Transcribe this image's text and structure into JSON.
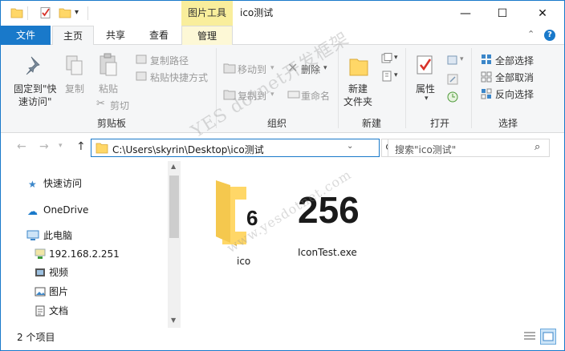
{
  "titlebar": {
    "context_tab": "图片工具",
    "title": "ico测试",
    "minimize": "—",
    "maximize": "☐",
    "close": "✕"
  },
  "tabs": {
    "file": "文件",
    "home": "主页",
    "share": "共享",
    "view": "查看",
    "manage": "管理"
  },
  "ribbon": {
    "clipboard": {
      "pin": "固定到\"快",
      "pin2": "速访问\"",
      "copy": "复制",
      "paste": "粘贴",
      "copy_path": "复制路径",
      "paste_shortcut": "粘贴快捷方式",
      "cut": "剪切",
      "label": "剪贴板"
    },
    "organize": {
      "move_to": "移动到",
      "copy_to": "复制到",
      "delete": "删除",
      "rename": "重命名",
      "label": "组织"
    },
    "new": {
      "new_folder": "新建",
      "new_folder2": "文件夹",
      "label": "新建"
    },
    "open": {
      "properties": "属性",
      "label": "打开"
    },
    "select": {
      "select_all": "全部选择",
      "select_none": "全部取消",
      "invert": "反向选择",
      "label": "选择"
    }
  },
  "address": {
    "path": "C:\\Users\\skyrin\\Desktop\\ico测试",
    "search_placeholder": "搜索\"ico测试\""
  },
  "nav": {
    "items": [
      {
        "label": "快速访问",
        "icon": "star-icon"
      },
      {
        "label": "OneDrive",
        "icon": "cloud-icon"
      },
      {
        "label": "此电脑",
        "icon": "computer-icon"
      },
      {
        "label": "192.168.2.251",
        "icon": "network-drive-icon"
      },
      {
        "label": "视频",
        "icon": "video-icon"
      },
      {
        "label": "图片",
        "icon": "picture-icon"
      },
      {
        "label": "文档",
        "icon": "document-icon"
      }
    ]
  },
  "files": [
    {
      "name": "ico",
      "overlay": "6",
      "icon": "folder-icon"
    },
    {
      "name": "IconTest.exe",
      "overlay": "256",
      "icon": "exe-icon"
    }
  ],
  "status": {
    "count": "2 个项目"
  },
  "watermark": {
    "line1": "YES dotnet开发框架",
    "line2": "www.yesdotnet.com"
  },
  "colors": {
    "accent": "#1979ca",
    "context_tab": "#f9ee9c",
    "ribbon_bg": "#f5f6f7",
    "folder": "#ffd767"
  }
}
